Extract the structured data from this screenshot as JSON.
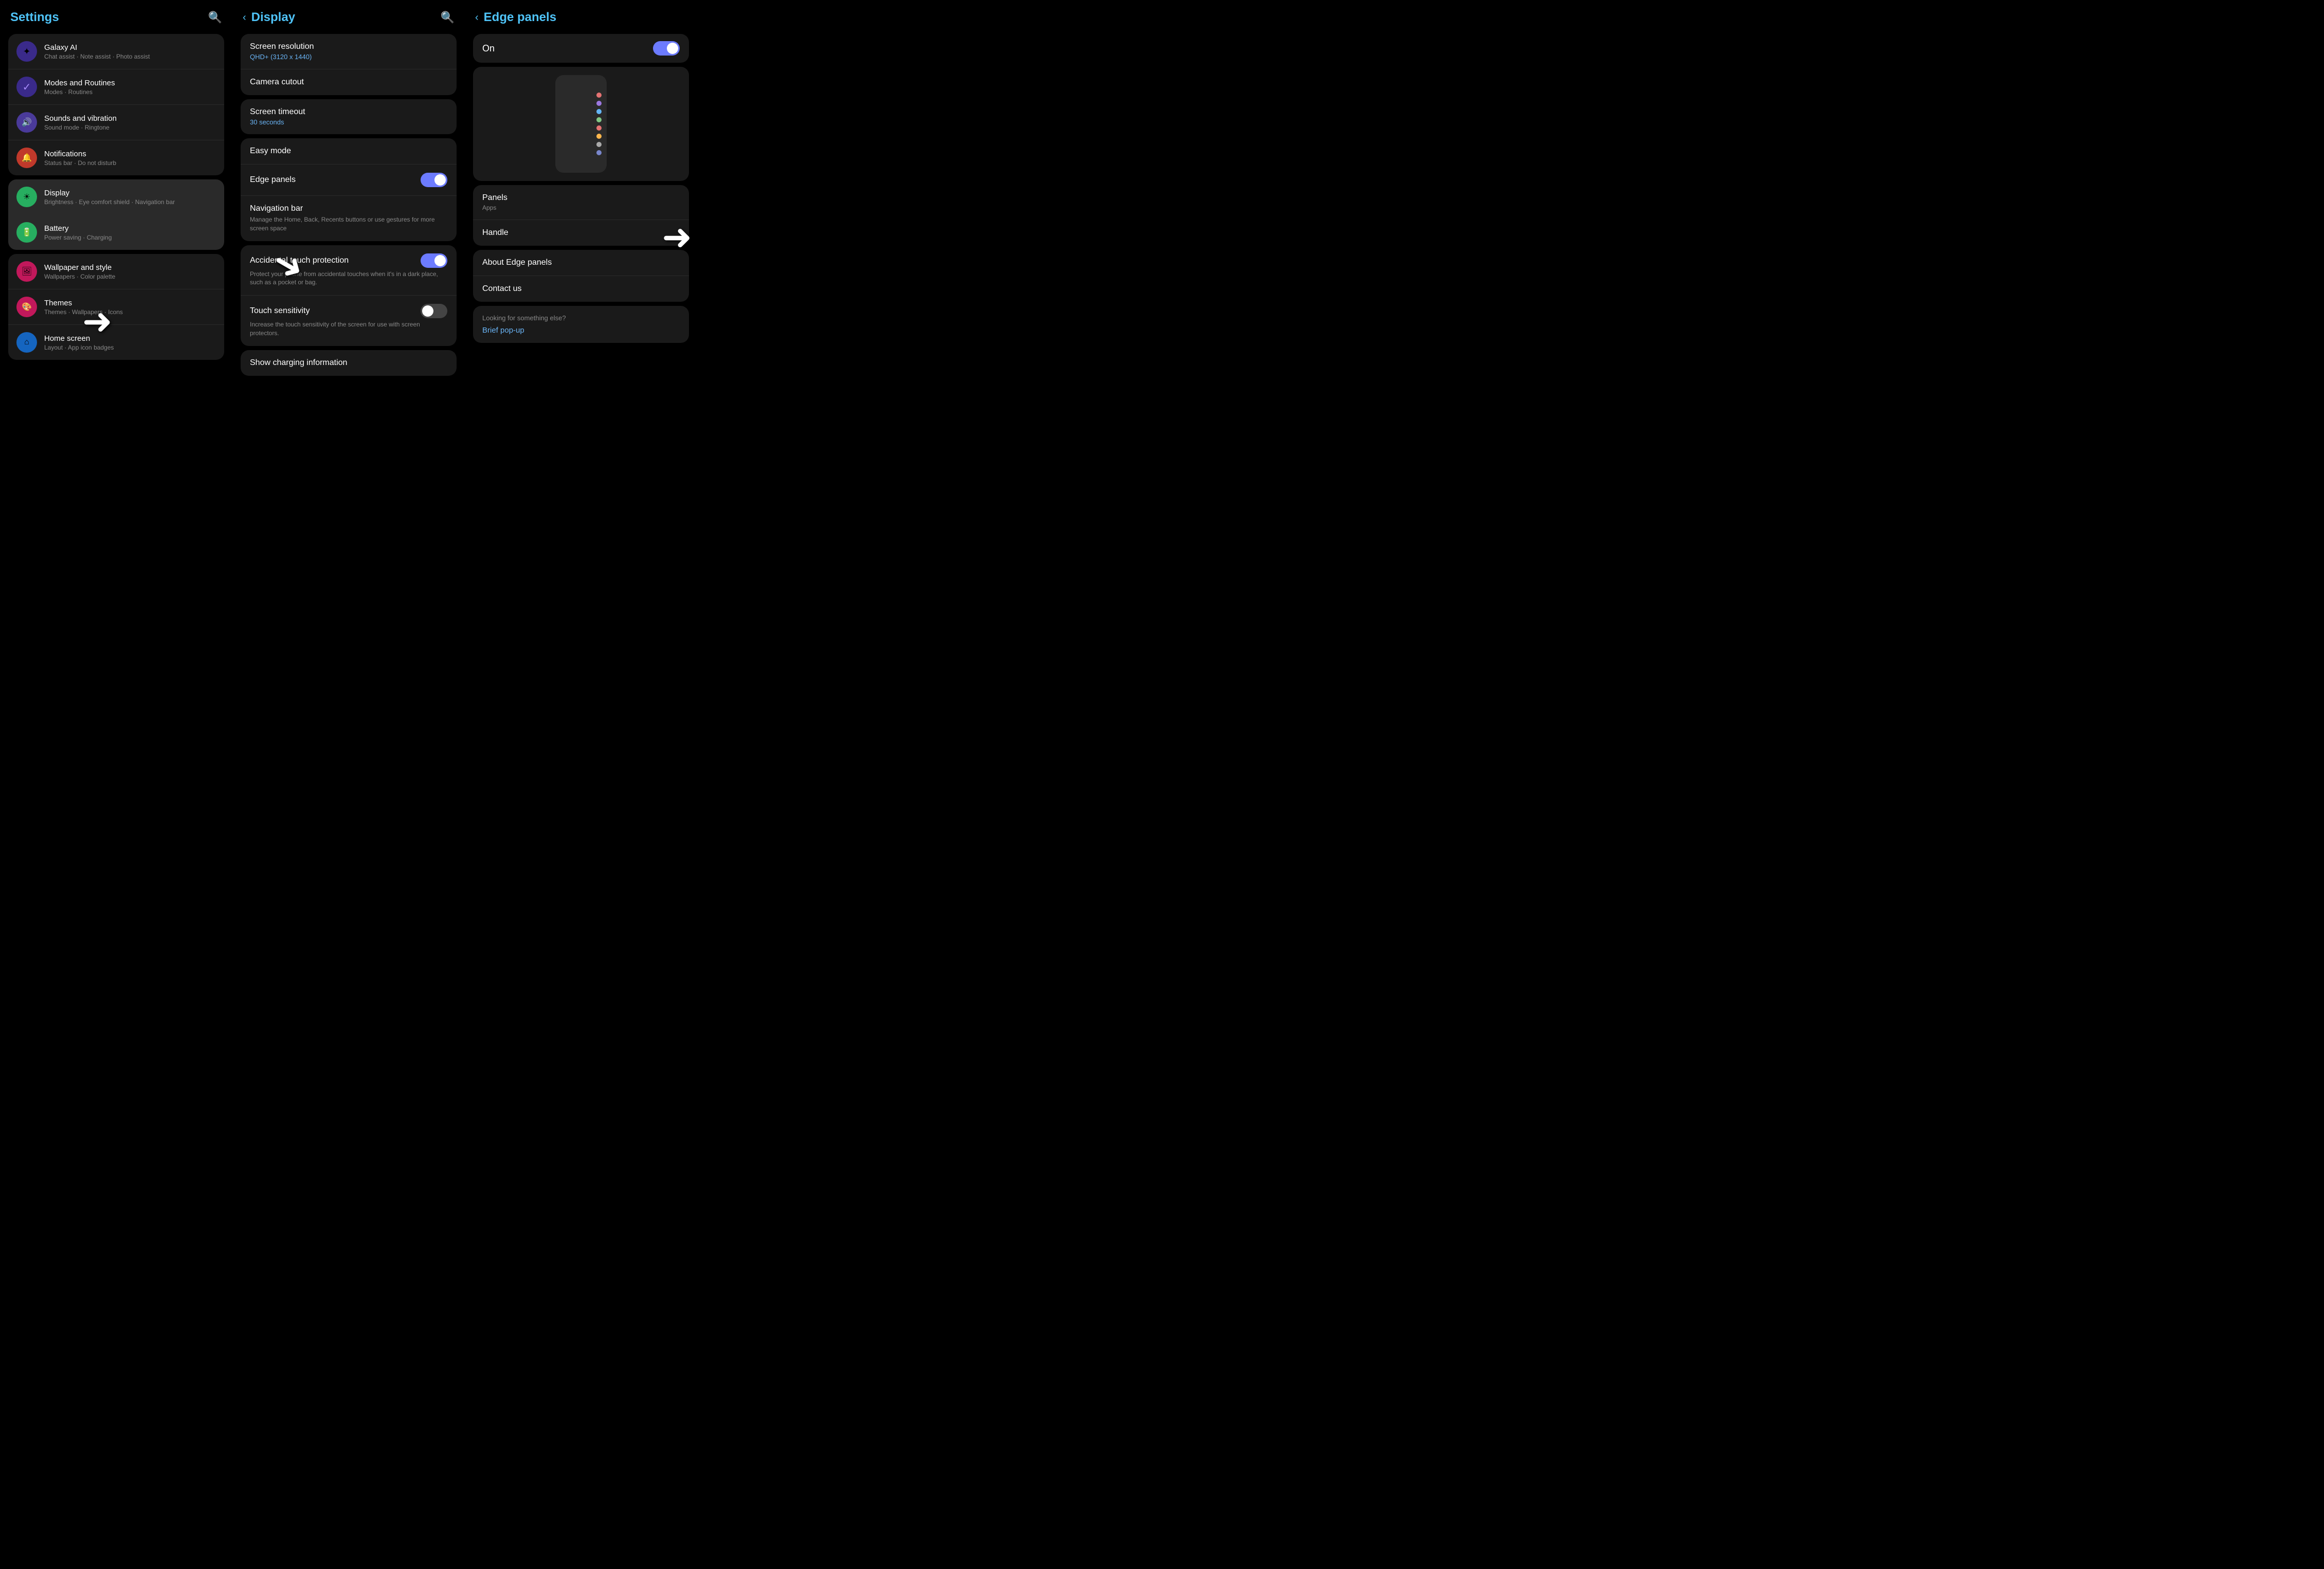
{
  "panel1": {
    "title": "Settings",
    "items_card1": [
      {
        "id": "galaxy-ai",
        "title": "Galaxy AI",
        "subtitle": "Chat assist · Note assist · Photo assist",
        "icon": "✦",
        "iconClass": "icon-galaxy"
      },
      {
        "id": "modes-routines",
        "title": "Modes and Routines",
        "subtitle": "Modes · Routines",
        "icon": "✓",
        "iconClass": "icon-modes"
      },
      {
        "id": "sounds",
        "title": "Sounds and vibration",
        "subtitle": "Sound mode · Ringtone",
        "icon": "🔊",
        "iconClass": "icon-sounds"
      },
      {
        "id": "notifications",
        "title": "Notifications",
        "subtitle": "Status bar · Do not disturb",
        "icon": "🔔",
        "iconClass": "icon-notif"
      }
    ],
    "items_card2": [
      {
        "id": "display",
        "title": "Display",
        "subtitle": "Brightness · Eye comfort shield · Navigation bar",
        "icon": "☀",
        "iconClass": "icon-display"
      },
      {
        "id": "battery",
        "title": "Battery",
        "subtitle": "Power saving · Charging",
        "icon": "🔋",
        "iconClass": "icon-battery"
      }
    ],
    "items_card3": [
      {
        "id": "wallpaper",
        "title": "Wallpaper and style",
        "subtitle": "Wallpapers · Color palette",
        "icon": "🖼",
        "iconClass": "icon-wallpaper"
      },
      {
        "id": "themes",
        "title": "Themes",
        "subtitle": "Themes · Wallpapers · Icons",
        "icon": "🎨",
        "iconClass": "icon-themes"
      },
      {
        "id": "home-screen",
        "title": "Home screen",
        "subtitle": "Layout · App icon badges",
        "icon": "⌂",
        "iconClass": "icon-home"
      }
    ]
  },
  "panel2": {
    "title": "Display",
    "items": [
      {
        "id": "screen-resolution",
        "title": "Screen resolution",
        "subtitle": "QHD+ (3120 x 1440)",
        "hasToggle": false,
        "desc": ""
      },
      {
        "id": "camera-cutout",
        "title": "Camera cutout",
        "subtitle": "",
        "hasToggle": false,
        "desc": ""
      },
      {
        "id": "screen-timeout",
        "title": "Screen timeout",
        "subtitle": "30 seconds",
        "hasToggle": false,
        "desc": ""
      },
      {
        "id": "easy-mode",
        "title": "Easy mode",
        "subtitle": "",
        "hasToggle": false,
        "desc": ""
      },
      {
        "id": "edge-panels",
        "title": "Edge panels",
        "subtitle": "",
        "hasToggle": true,
        "toggleOn": true,
        "desc": ""
      },
      {
        "id": "navigation-bar",
        "title": "Navigation bar",
        "subtitle": "",
        "hasToggle": false,
        "desc": "Manage the Home, Back, Recents buttons or use gestures for more screen space"
      },
      {
        "id": "accidental-touch",
        "title": "Accidental touch protection",
        "subtitle": "",
        "hasToggle": true,
        "toggleOn": true,
        "desc": "Protect your phone from accidental touches when it's in a dark place, such as a pocket or bag."
      },
      {
        "id": "touch-sensitivity",
        "title": "Touch sensitivity",
        "subtitle": "",
        "hasToggle": true,
        "toggleOn": false,
        "desc": "Increase the touch sensitivity of the screen for use with screen protectors."
      },
      {
        "id": "show-charging",
        "title": "Show charging information",
        "subtitle": "",
        "hasToggle": false,
        "desc": ""
      }
    ]
  },
  "panel3": {
    "title": "Edge panels",
    "on_label": "On",
    "toggle_on": true,
    "dots": [
      {
        "color": "#e57373"
      },
      {
        "color": "#9c78e0"
      },
      {
        "color": "#64b5f6"
      },
      {
        "color": "#81c784"
      },
      {
        "color": "#e57373"
      },
      {
        "color": "#ffb74d"
      },
      {
        "color": "#aaa"
      },
      {
        "color": "#7986cb"
      }
    ],
    "list_items": [
      {
        "id": "panels",
        "title": "Panels",
        "subtitle": "Apps"
      },
      {
        "id": "handle",
        "title": "Handle",
        "subtitle": ""
      }
    ],
    "about_items": [
      {
        "id": "about-edge",
        "title": "About Edge panels",
        "subtitle": ""
      },
      {
        "id": "contact-us",
        "title": "Contact us",
        "subtitle": ""
      }
    ],
    "looking_label": "Looking for something else?",
    "brief_popup": "Brief pop-up"
  }
}
